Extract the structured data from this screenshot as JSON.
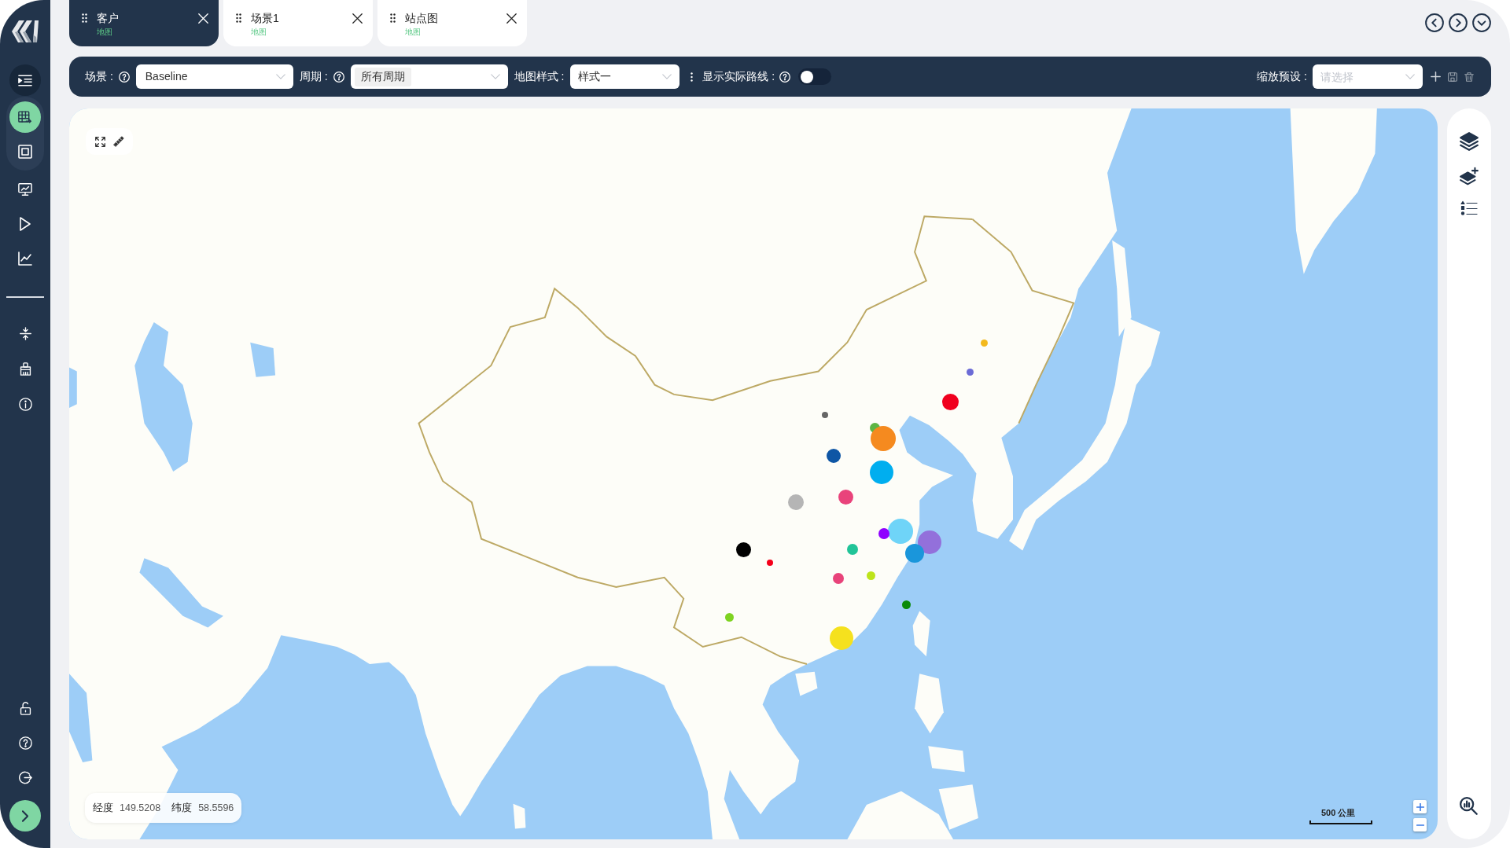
{
  "tabs": [
    {
      "title": "客户",
      "subtitle": "地图",
      "selected": true
    },
    {
      "title": "场景1",
      "subtitle": "地图",
      "selected": false
    },
    {
      "title": "站点图",
      "subtitle": "地图",
      "selected": false
    }
  ],
  "sidebar": {
    "nav_items": [
      {
        "selected": true
      },
      {
        "selected": false
      },
      {
        "selected": false
      },
      {
        "selected": false
      },
      {
        "selected": false
      }
    ]
  },
  "toolbar": {
    "scenario": {
      "label": "场景 :",
      "value": "Baseline"
    },
    "period": {
      "label": "周期 :",
      "tags": [
        "所有周期"
      ]
    },
    "map_style": {
      "label": "地图样式 :",
      "value": "样式一"
    },
    "actual_routes": {
      "label": "显示实际路线 :",
      "on": false
    },
    "zoom_preset": {
      "label": "缩放预设 :",
      "placeholder": "请选择"
    }
  },
  "map": {
    "markers": [
      {
        "color": "#f3b91d"
      },
      {
        "color": "#6b6bd6"
      },
      {
        "color": "#f0001e"
      },
      {
        "color": "#666666"
      },
      {
        "color": "#5db544"
      },
      {
        "color": "#f58a1f"
      },
      {
        "color": "#0e56a5"
      },
      {
        "color": "#00aeef"
      },
      {
        "color": "#e9437b"
      },
      {
        "color": "#b5b5b5"
      },
      {
        "color": "#6fd4f8"
      },
      {
        "color": "#8f00ff"
      },
      {
        "color": "#9370db"
      },
      {
        "color": "#21c498"
      },
      {
        "color": "#000000"
      },
      {
        "color": "#1a96db"
      },
      {
        "color": "#f5001a"
      },
      {
        "color": "#bde41a"
      },
      {
        "color": "#e8437a"
      },
      {
        "color": "#0a8a0a"
      },
      {
        "color": "#7ed321"
      },
      {
        "color": "#f5e11e"
      }
    ],
    "coordinates": {
      "longitude_label": "经度",
      "longitude": "149.5208",
      "latitude_label": "纬度",
      "latitude": "58.5596"
    },
    "scale_label": "500 公里"
  }
}
